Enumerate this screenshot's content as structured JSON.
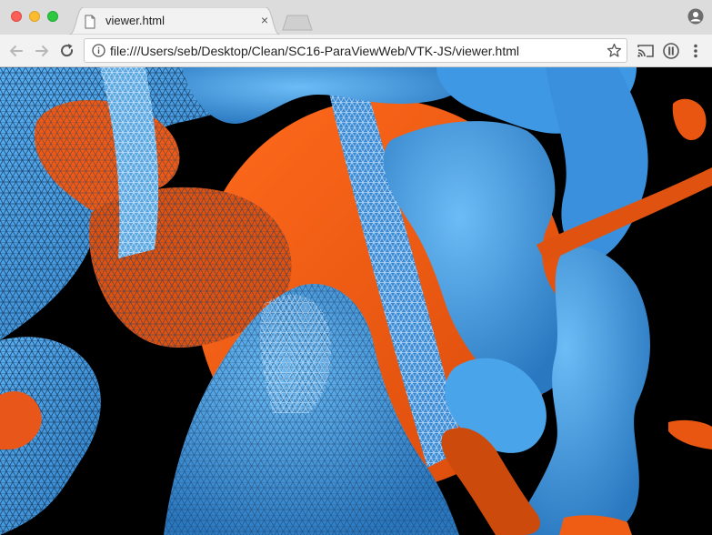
{
  "window": {
    "controls": [
      "close-icon",
      "minimize-icon",
      "maximize-icon"
    ]
  },
  "tab": {
    "title": "viewer.html",
    "icon": "document-icon",
    "close_label": "×"
  },
  "toolbar": {
    "back_icon": "back-arrow-icon",
    "forward_icon": "forward-arrow-icon",
    "reload_icon": "reload-icon",
    "url": "file:///Users/seb/Desktop/Clean/SC16-ParaViewWeb/VTK-JS/viewer.html",
    "right_icons": [
      "bookmark-star-icon",
      "cast-icon",
      "extension-icon",
      "menu-icon",
      "profile-icon"
    ]
  },
  "colors": {
    "surface_blue": "#3f9be6",
    "surface_orange": "#ff5a10",
    "background": "#000000",
    "chrome_bg": "#dcdcdc"
  }
}
